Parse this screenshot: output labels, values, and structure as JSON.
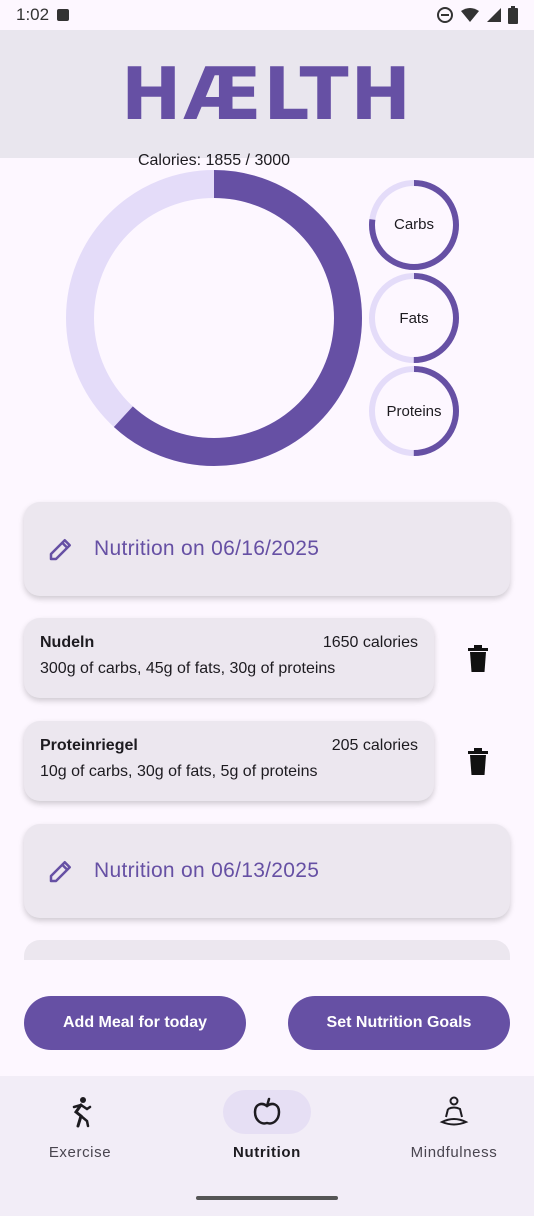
{
  "status_bar": {
    "time": "1:02"
  },
  "app": {
    "title": "HÆLTH",
    "accent": "#6650a4",
    "track": "#e4dcf9"
  },
  "summary": {
    "calories_label": "Calories: 1855 / 3000",
    "calories_progress": 0.618,
    "macros": [
      {
        "label": "Carbs",
        "progress": 0.77
      },
      {
        "label": "Fats",
        "progress": 0.5
      },
      {
        "label": "Proteins",
        "progress": 0.5
      }
    ]
  },
  "days": [
    {
      "label": "Nutrition on 06/16/2025",
      "meals": [
        {
          "name": "Nudeln",
          "calories": "1650 calories",
          "details": "300g of carbs, 45g of fats, 30g of proteins"
        },
        {
          "name": "Proteinriegel",
          "calories": "205 calories",
          "details": "10g of carbs, 30g of fats, 5g of proteins"
        }
      ]
    },
    {
      "label": "Nutrition on 06/13/2025"
    }
  ],
  "actions": {
    "add_meal": "Add Meal for today",
    "set_goals": "Set Nutrition Goals"
  },
  "nav": [
    {
      "label": "Exercise",
      "icon": "run-icon"
    },
    {
      "label": "Nutrition",
      "icon": "apple-icon",
      "active": true
    },
    {
      "label": "Mindfulness",
      "icon": "meditation-icon"
    }
  ]
}
